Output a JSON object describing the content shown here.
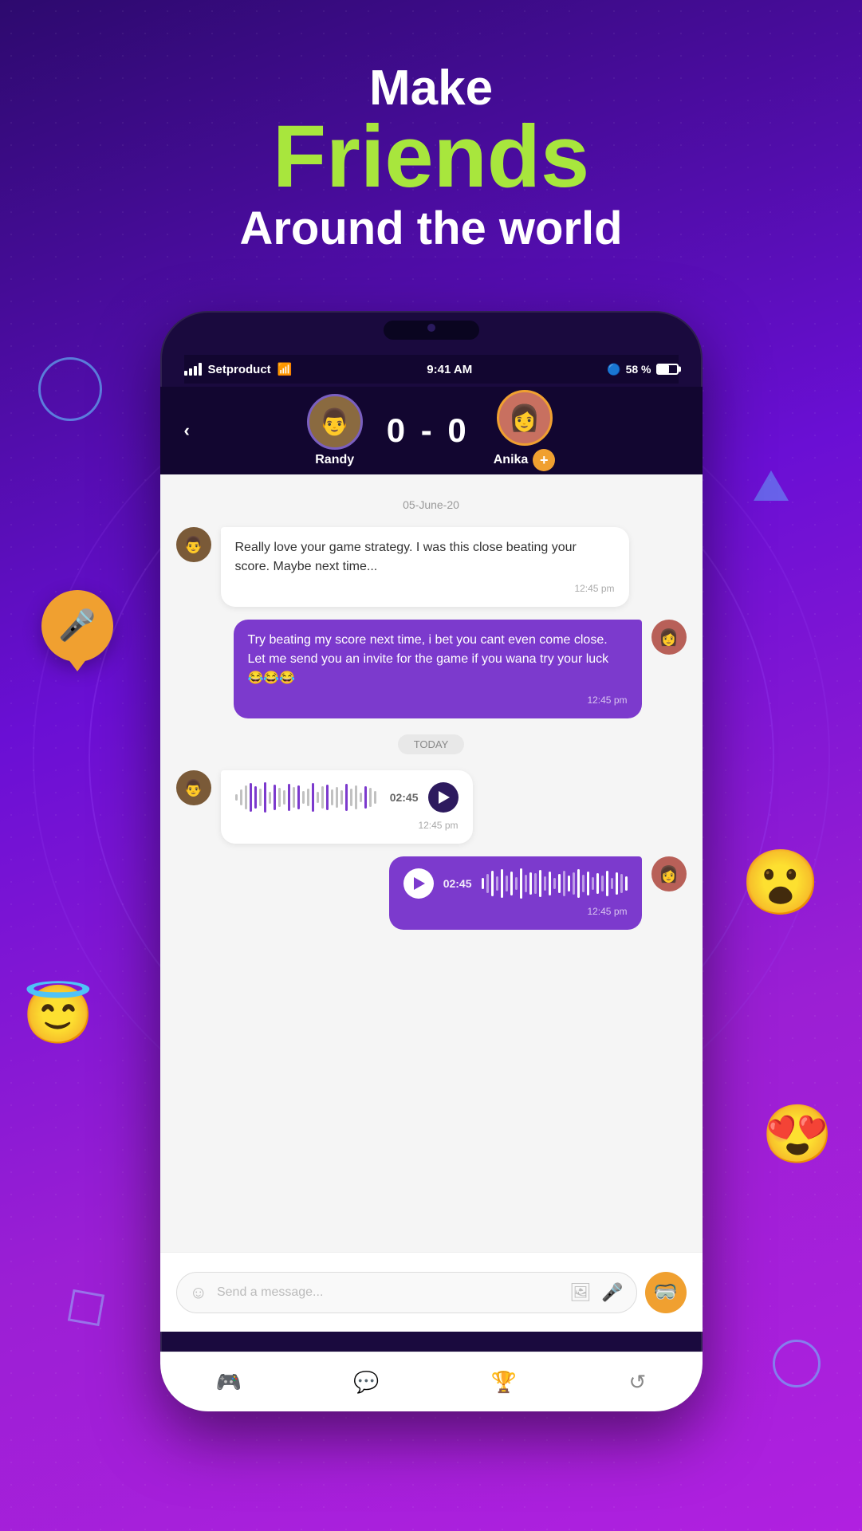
{
  "header": {
    "make": "Make",
    "friends": "Friends",
    "around": "Around the world"
  },
  "statusBar": {
    "carrier": "Setproduct",
    "time": "9:41 AM",
    "battery": "58 %",
    "wifi": "wifi"
  },
  "gameHeader": {
    "backIcon": "‹",
    "player1Name": "Randy",
    "player2Name": "Anika",
    "score": "0 - 0",
    "addIcon": "+"
  },
  "chat": {
    "dateLabel": "05-June-20",
    "todayLabel": "TODAY",
    "message1": {
      "text": "Really love your game strategy. I was this close beating your score. Maybe next time...",
      "time": "12:45 pm",
      "type": "received"
    },
    "message2": {
      "text": "Try beating my score next time, i bet you cant even come close. Let me send you an invite for the game if you wana try your luck 😂😂😂",
      "time": "12:45 pm",
      "type": "sent"
    },
    "voiceReceived": {
      "duration": "02:45",
      "time": "12:45 pm",
      "type": "received"
    },
    "voiceSent": {
      "duration": "02:45",
      "time": "12:45 pm",
      "type": "sent"
    }
  },
  "inputBar": {
    "placeholder": "Send a message...",
    "smileyIcon": "☺",
    "imageIcon": "🖼",
    "micIcon": "🎤",
    "maskIcon": "🥽"
  },
  "bottomNav": {
    "items": [
      {
        "icon": "🎮",
        "label": "games"
      },
      {
        "icon": "💬",
        "label": "chat"
      },
      {
        "icon": "🏆",
        "label": "trophy"
      },
      {
        "icon": "↺",
        "label": "replay"
      }
    ]
  },
  "decorations": {
    "floatingEmojis": [
      "😮",
      "😇",
      "😍"
    ],
    "micBubble": "🎤"
  }
}
